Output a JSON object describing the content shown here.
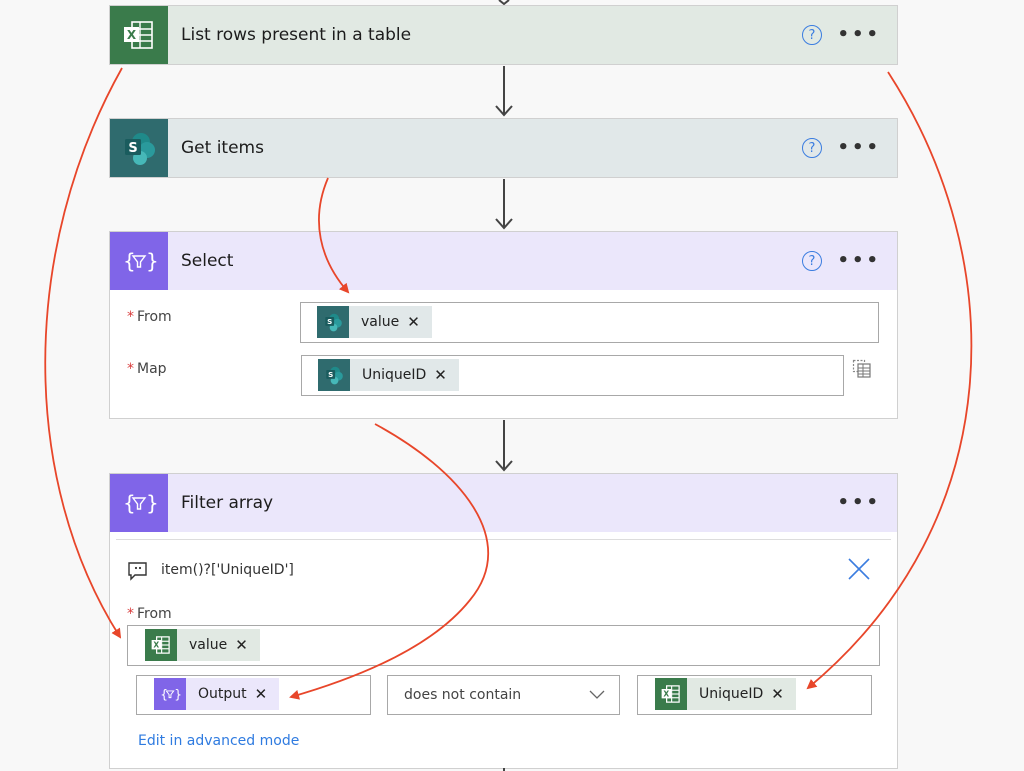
{
  "steps": [
    {
      "title": "List rows present in a table",
      "icon": "excel-icon",
      "color": "#3a7b4b"
    },
    {
      "title": "Get items",
      "icon": "sharepoint-icon",
      "color": "#2f6b6e"
    },
    {
      "title": "Select",
      "icon": "data-operation-icon",
      "color": "#8065e8"
    },
    {
      "title": "Filter array",
      "icon": "data-operation-icon",
      "color": "#8065e8"
    }
  ],
  "select": {
    "from_label": "From",
    "from_token": "value",
    "map_label": "Map",
    "map_token": "UniqueID"
  },
  "filter": {
    "comment": "item()?['UniqueID']",
    "from_label": "From",
    "from_token": "value",
    "left_token": "Output",
    "operator": "does not contain",
    "right_token": "UniqueID",
    "advanced_link": "Edit in advanced mode"
  },
  "glyphs": {
    "help": "?",
    "more": "•••",
    "remove": "✕",
    "required": "*",
    "close": "✕"
  },
  "colors": {
    "annotation_arrow": "#e8462a",
    "link": "#2f7be0"
  }
}
